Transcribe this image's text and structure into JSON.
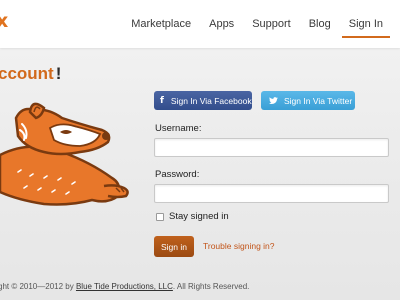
{
  "header": {
    "logo": "x",
    "nav": [
      "Marketplace",
      "Apps",
      "Support",
      "Blog",
      "Sign In"
    ],
    "active_index": 4
  },
  "main": {
    "heading": "ccount",
    "heading_suffix": "!"
  },
  "social": {
    "facebook_label": "Sign In Via Facebook",
    "facebook_icon": "facebook-f-icon",
    "twitter_label": "Sign In Via Twitter",
    "twitter_icon": "twitter-bird-icon"
  },
  "form": {
    "username_label": "Username:",
    "username_value": "",
    "password_label": "Password:",
    "password_value": "",
    "remember_label": "Stay signed in",
    "remember_checked": false,
    "signin_label": "Sign in",
    "trouble_label": "Trouble signing in?"
  },
  "footer": {
    "prefix": "ght © 2010—2012 by ",
    "link": "Blue Tide Productions, LLC",
    "suffix": ". All Rights Reserved."
  },
  "colors": {
    "accent": "#d26a1c",
    "facebook": "#3b5998",
    "twitter": "#4aaee0",
    "link": "#c2551a"
  }
}
